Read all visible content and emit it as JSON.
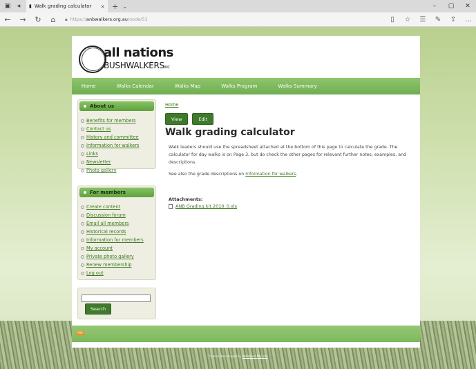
{
  "browser": {
    "tab_title": "Walk grading calculator",
    "tab_close": "×",
    "new_tab": "+",
    "url_scheme": "https://",
    "url_host": "anbwalkers.org.au",
    "url_path": "/node/51",
    "win_min": "–",
    "win_max": "▢",
    "win_close": "✕"
  },
  "logo": {
    "line1": "all nations",
    "line2": "BUSHWALKERS",
    "suffix": "INC"
  },
  "nav": [
    "Home",
    "Walks Calendar",
    "Walks Map",
    "Walks Program",
    "Walks Summary"
  ],
  "about": {
    "title": "About us",
    "items": [
      "Benefits for members",
      "Contact us",
      "History and committee",
      "Information for walkers",
      "Links",
      "Newsletter",
      "Photo gallery"
    ]
  },
  "members": {
    "title": "For members",
    "items": [
      "Create content",
      "Discussion forum",
      "Email all members",
      "Historical records",
      "Information for members",
      "My account",
      "Private photo gallery",
      "Renew membership",
      "Log out"
    ]
  },
  "search": {
    "value": "",
    "button": "Search"
  },
  "content": {
    "breadcrumb": "Home",
    "tab_view": "View",
    "tab_edit": "Edit",
    "title": "Walk grading calculator",
    "para1": "Walk leaders should use the spreadsheet attached at the bottom of this page to calculate the grade. The calculator for day walks is on Page 3, but do check the other pages for relevant further notes, examples, and descriptions.",
    "para2_prefix": "See also the grade descriptions on ",
    "para2_link": "Information for walkers",
    "para2_suffix": ".",
    "attachments_label": "Attachments:",
    "attachment_file": "ANB Grading kit 2010_0.xls"
  },
  "footer": {
    "rss": "RSS",
    "credit_prefix": "Theme developed by ",
    "credit_link": "Antsnest Pty Ltd"
  }
}
